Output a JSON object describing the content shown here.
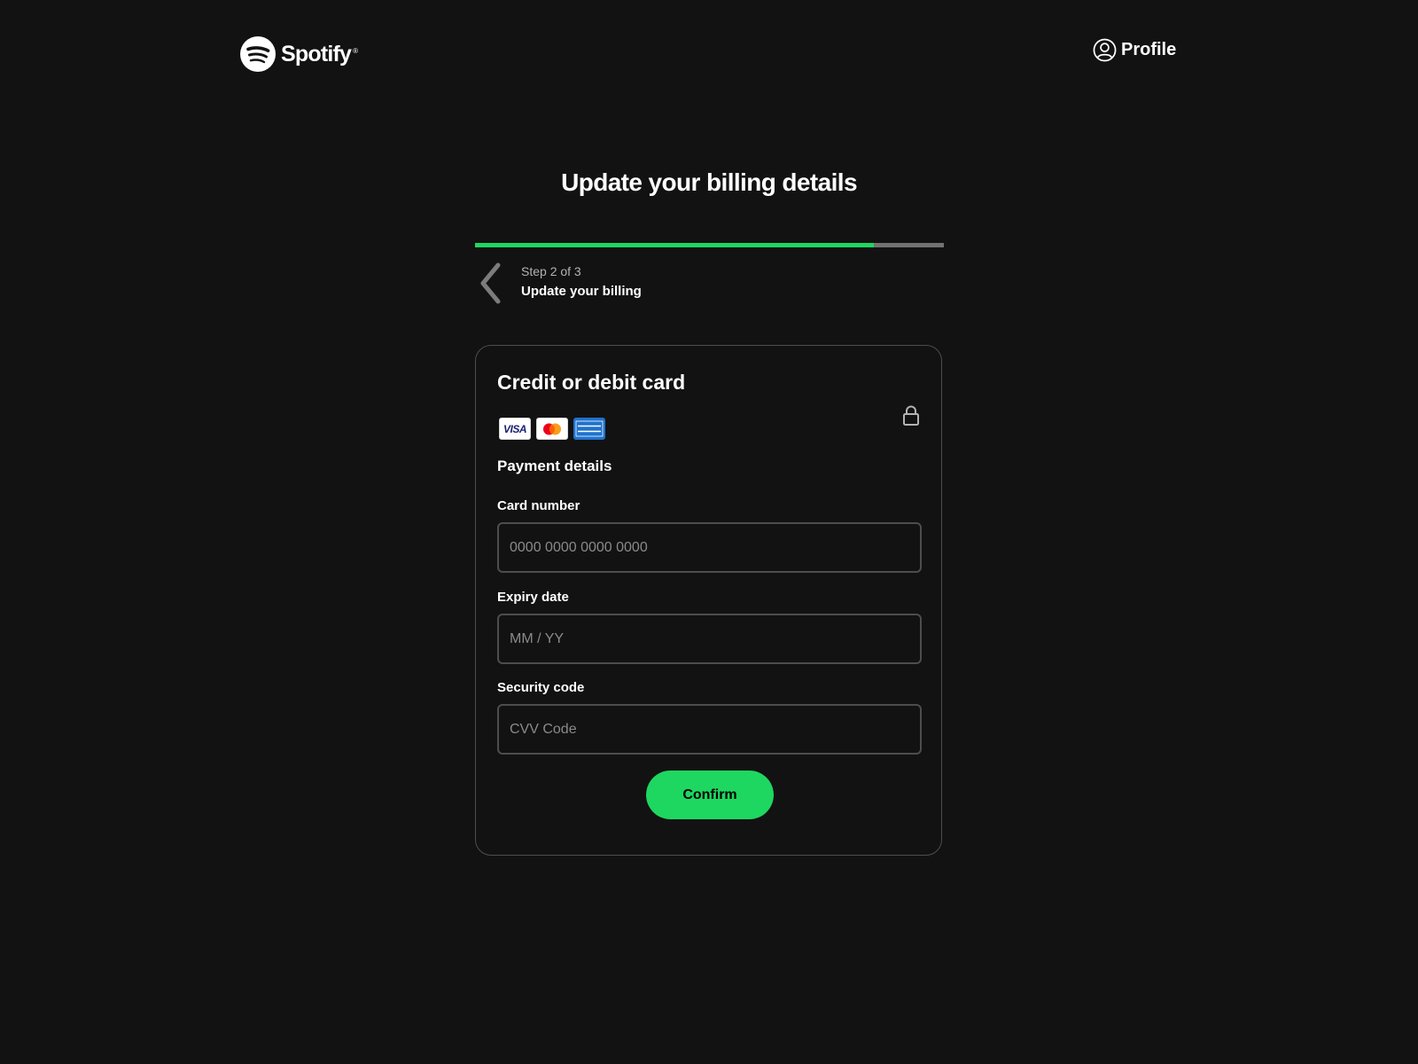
{
  "header": {
    "brand": "Spotify",
    "brand_mark": "®",
    "profile_label": "Profile"
  },
  "page": {
    "title": "Update your billing details"
  },
  "progress": {
    "step_current": 2,
    "step_total": 3,
    "step_count_label": "Step 2 of 3",
    "step_title": "Update your billing",
    "fill_fraction": 0.85
  },
  "card": {
    "title": "Credit or debit card",
    "brands": [
      "visa",
      "mastercard",
      "american-express"
    ],
    "visa_label": "VISA",
    "section_title": "Payment details",
    "fields": {
      "card_number": {
        "label": "Card number",
        "placeholder": "0000 0000 0000 0000",
        "value": ""
      },
      "expiry": {
        "label": "Expiry date",
        "placeholder": "MM / YY",
        "value": ""
      },
      "cvv": {
        "label": "Security code",
        "placeholder": "CVV Code",
        "value": ""
      }
    },
    "confirm_label": "Confirm"
  },
  "icons": {
    "logo": "spotify-logo-icon",
    "profile": "user-circle-icon",
    "back": "chevron-left-icon",
    "lock": "lock-icon"
  },
  "colors": {
    "background": "#121212",
    "accent": "#1ed760",
    "progress_track": "#727272",
    "border": "#4d4d4d",
    "muted_text": "#b3b3b3"
  }
}
